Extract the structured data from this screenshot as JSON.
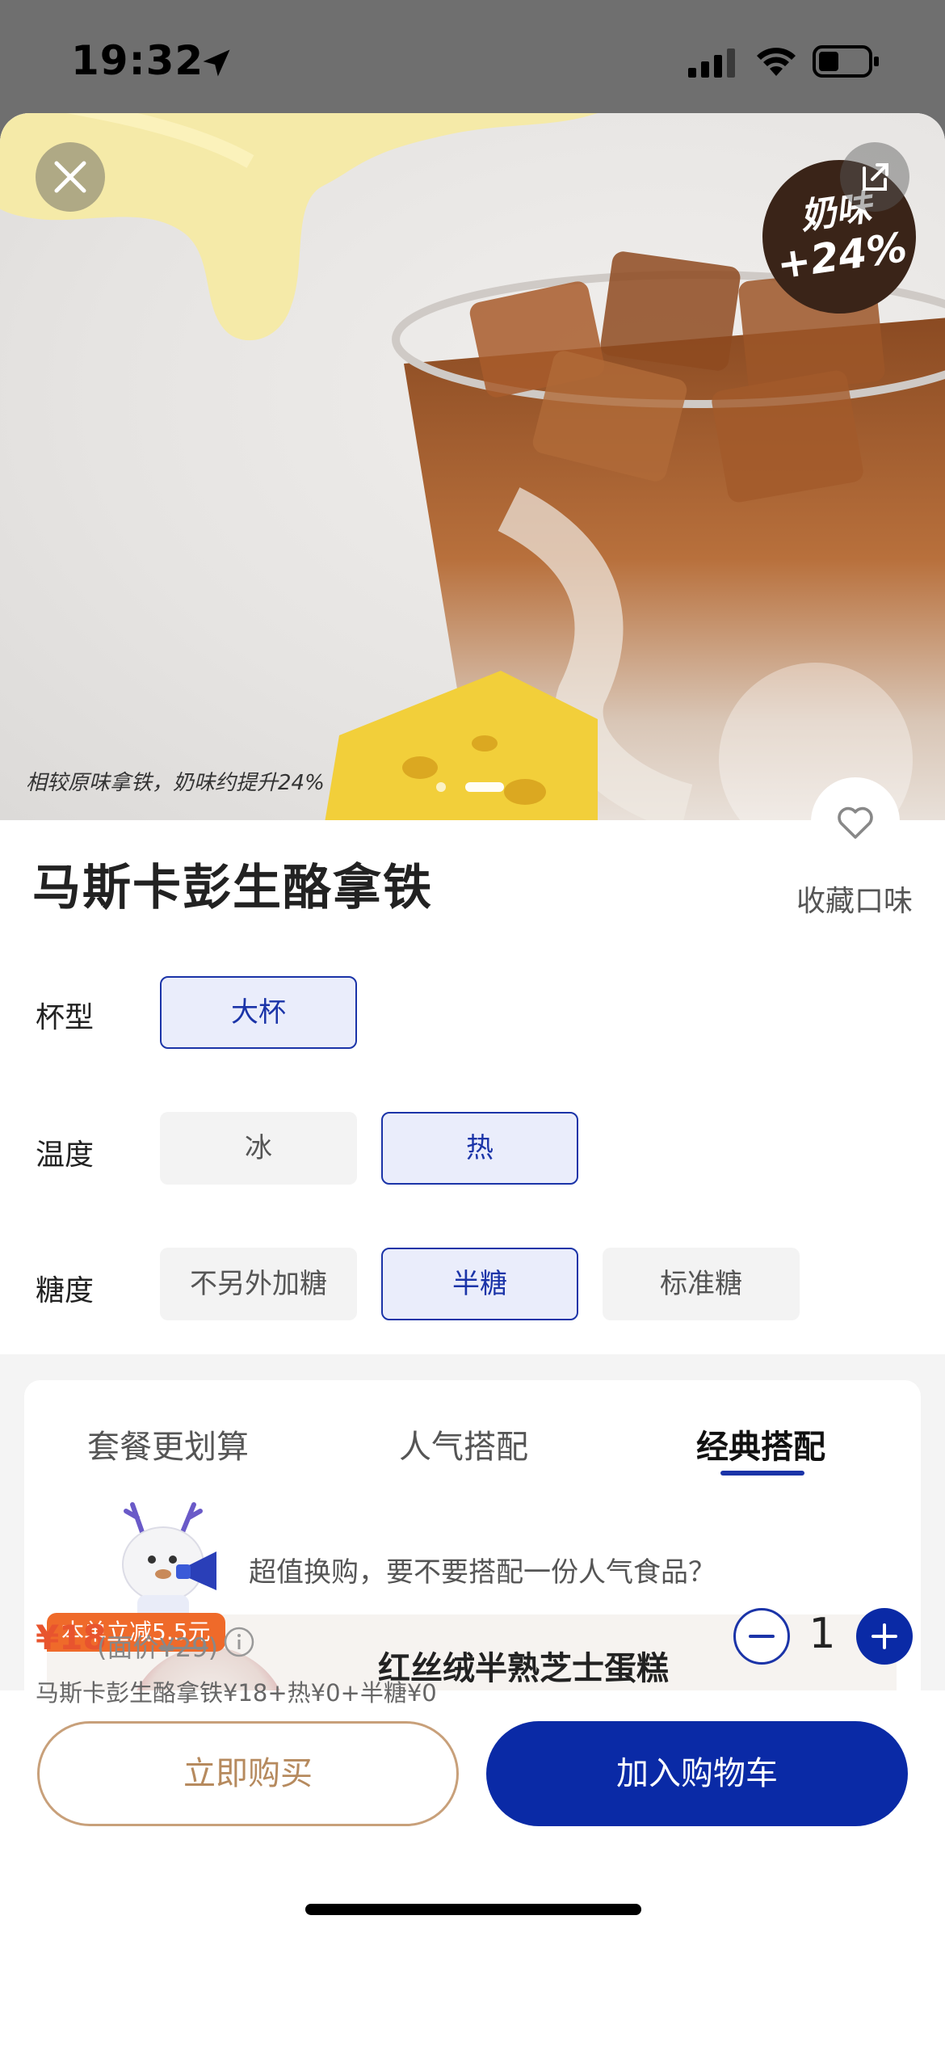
{
  "status_bar": {
    "time": "19:32"
  },
  "hero": {
    "badge_line1": "奶味",
    "badge_line2": "+24%",
    "caption": "相较原味拿铁，奶味约提升24%",
    "slide_count": 2,
    "active_slide": 2
  },
  "product": {
    "title": "马斯卡彭生酪拿铁",
    "favorite_label": "收藏口味"
  },
  "options": {
    "cup": {
      "label": "杯型",
      "choices": [
        "大杯"
      ],
      "selected": "大杯"
    },
    "temperature": {
      "label": "温度",
      "choices": [
        "冰",
        "热"
      ],
      "selected": "热"
    },
    "sugar": {
      "label": "糖度",
      "choices": [
        "不另外加糖",
        "半糖",
        "标准糖"
      ],
      "selected": "半糖"
    }
  },
  "combo": {
    "tabs": [
      "套餐更划算",
      "人气搭配",
      "经典搭配"
    ],
    "active_tab": "经典搭配",
    "promo_text": "超值换购，要不要搭配一份人气食品？",
    "item": {
      "discount_tag": "本单立减5.5元",
      "name": "红丝绒半熟芝士蛋糕"
    }
  },
  "checkout": {
    "price": "¥18",
    "face_prefix": "(面价",
    "face_value": "¥29",
    "face_suffix": ")",
    "breakdown": "马斯卡彭生酪拿铁¥18+热¥0+半糖¥0",
    "quantity": "1",
    "buy_now_label": "立即购买",
    "add_cart_label": "加入购物车"
  },
  "colors": {
    "brand_blue": "#0a2aa6",
    "price_orange": "#e8542e",
    "buy_now_gold": "#b68a5e",
    "discount_orange": "#ef6a2a"
  }
}
